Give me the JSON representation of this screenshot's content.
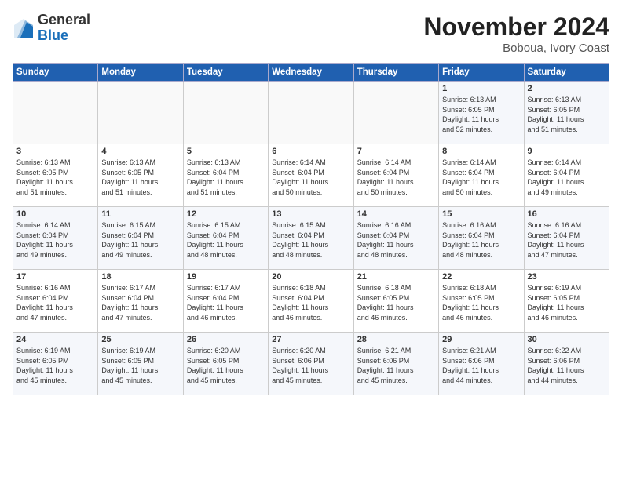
{
  "logo": {
    "general": "General",
    "blue": "Blue"
  },
  "header": {
    "month": "November 2024",
    "location": "Boboua, Ivory Coast"
  },
  "weekdays": [
    "Sunday",
    "Monday",
    "Tuesday",
    "Wednesday",
    "Thursday",
    "Friday",
    "Saturday"
  ],
  "weeks": [
    [
      {
        "day": "",
        "info": ""
      },
      {
        "day": "",
        "info": ""
      },
      {
        "day": "",
        "info": ""
      },
      {
        "day": "",
        "info": ""
      },
      {
        "day": "",
        "info": ""
      },
      {
        "day": "1",
        "info": "Sunrise: 6:13 AM\nSunset: 6:05 PM\nDaylight: 11 hours\nand 52 minutes."
      },
      {
        "day": "2",
        "info": "Sunrise: 6:13 AM\nSunset: 6:05 PM\nDaylight: 11 hours\nand 51 minutes."
      }
    ],
    [
      {
        "day": "3",
        "info": "Sunrise: 6:13 AM\nSunset: 6:05 PM\nDaylight: 11 hours\nand 51 minutes."
      },
      {
        "day": "4",
        "info": "Sunrise: 6:13 AM\nSunset: 6:05 PM\nDaylight: 11 hours\nand 51 minutes."
      },
      {
        "day": "5",
        "info": "Sunrise: 6:13 AM\nSunset: 6:04 PM\nDaylight: 11 hours\nand 51 minutes."
      },
      {
        "day": "6",
        "info": "Sunrise: 6:14 AM\nSunset: 6:04 PM\nDaylight: 11 hours\nand 50 minutes."
      },
      {
        "day": "7",
        "info": "Sunrise: 6:14 AM\nSunset: 6:04 PM\nDaylight: 11 hours\nand 50 minutes."
      },
      {
        "day": "8",
        "info": "Sunrise: 6:14 AM\nSunset: 6:04 PM\nDaylight: 11 hours\nand 50 minutes."
      },
      {
        "day": "9",
        "info": "Sunrise: 6:14 AM\nSunset: 6:04 PM\nDaylight: 11 hours\nand 49 minutes."
      }
    ],
    [
      {
        "day": "10",
        "info": "Sunrise: 6:14 AM\nSunset: 6:04 PM\nDaylight: 11 hours\nand 49 minutes."
      },
      {
        "day": "11",
        "info": "Sunrise: 6:15 AM\nSunset: 6:04 PM\nDaylight: 11 hours\nand 49 minutes."
      },
      {
        "day": "12",
        "info": "Sunrise: 6:15 AM\nSunset: 6:04 PM\nDaylight: 11 hours\nand 48 minutes."
      },
      {
        "day": "13",
        "info": "Sunrise: 6:15 AM\nSunset: 6:04 PM\nDaylight: 11 hours\nand 48 minutes."
      },
      {
        "day": "14",
        "info": "Sunrise: 6:16 AM\nSunset: 6:04 PM\nDaylight: 11 hours\nand 48 minutes."
      },
      {
        "day": "15",
        "info": "Sunrise: 6:16 AM\nSunset: 6:04 PM\nDaylight: 11 hours\nand 48 minutes."
      },
      {
        "day": "16",
        "info": "Sunrise: 6:16 AM\nSunset: 6:04 PM\nDaylight: 11 hours\nand 47 minutes."
      }
    ],
    [
      {
        "day": "17",
        "info": "Sunrise: 6:16 AM\nSunset: 6:04 PM\nDaylight: 11 hours\nand 47 minutes."
      },
      {
        "day": "18",
        "info": "Sunrise: 6:17 AM\nSunset: 6:04 PM\nDaylight: 11 hours\nand 47 minutes."
      },
      {
        "day": "19",
        "info": "Sunrise: 6:17 AM\nSunset: 6:04 PM\nDaylight: 11 hours\nand 46 minutes."
      },
      {
        "day": "20",
        "info": "Sunrise: 6:18 AM\nSunset: 6:04 PM\nDaylight: 11 hours\nand 46 minutes."
      },
      {
        "day": "21",
        "info": "Sunrise: 6:18 AM\nSunset: 6:05 PM\nDaylight: 11 hours\nand 46 minutes."
      },
      {
        "day": "22",
        "info": "Sunrise: 6:18 AM\nSunset: 6:05 PM\nDaylight: 11 hours\nand 46 minutes."
      },
      {
        "day": "23",
        "info": "Sunrise: 6:19 AM\nSunset: 6:05 PM\nDaylight: 11 hours\nand 46 minutes."
      }
    ],
    [
      {
        "day": "24",
        "info": "Sunrise: 6:19 AM\nSunset: 6:05 PM\nDaylight: 11 hours\nand 45 minutes."
      },
      {
        "day": "25",
        "info": "Sunrise: 6:19 AM\nSunset: 6:05 PM\nDaylight: 11 hours\nand 45 minutes."
      },
      {
        "day": "26",
        "info": "Sunrise: 6:20 AM\nSunset: 6:05 PM\nDaylight: 11 hours\nand 45 minutes."
      },
      {
        "day": "27",
        "info": "Sunrise: 6:20 AM\nSunset: 6:06 PM\nDaylight: 11 hours\nand 45 minutes."
      },
      {
        "day": "28",
        "info": "Sunrise: 6:21 AM\nSunset: 6:06 PM\nDaylight: 11 hours\nand 45 minutes."
      },
      {
        "day": "29",
        "info": "Sunrise: 6:21 AM\nSunset: 6:06 PM\nDaylight: 11 hours\nand 44 minutes."
      },
      {
        "day": "30",
        "info": "Sunrise: 6:22 AM\nSunset: 6:06 PM\nDaylight: 11 hours\nand 44 minutes."
      }
    ]
  ]
}
